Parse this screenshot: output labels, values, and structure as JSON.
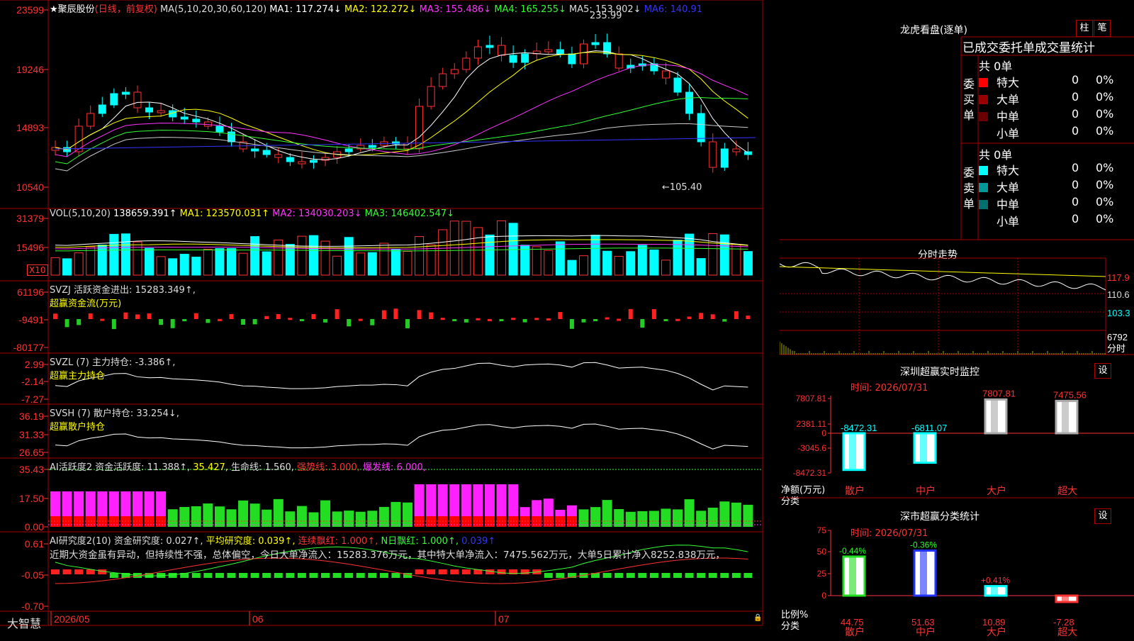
{
  "stock": {
    "star": "★",
    "name": "聚辰股份",
    "mode": "(日线，前复权)"
  },
  "ma_header": [
    {
      "label": "MA(5,10,20,30,60,120)",
      "color": "#dddddd"
    },
    {
      "label": "MA1: 117.274↓",
      "color": "#ffffff"
    },
    {
      "label": "MA2: 122.272↓",
      "color": "#ffff00"
    },
    {
      "label": "MA3: 155.486↓",
      "color": "#ff33ff"
    },
    {
      "label": "MA4: 165.255↓",
      "color": "#33ff33"
    },
    {
      "label": "MA5: 153.902↓",
      "color": "#dddddd"
    },
    {
      "label": "MA6: 140.91",
      "color": "#3333ff"
    }
  ],
  "price_axis": [
    "23599",
    "19246",
    "14893",
    "10540"
  ],
  "price_marks": {
    "high": "235.99",
    "low": "←105.40"
  },
  "vol_header": [
    {
      "label": "VOL(5,10,20)",
      "color": "#dddddd"
    },
    {
      "label": "138659.391↑",
      "color": "#ffffff"
    },
    {
      "label": "MA1: 123570.031↑",
      "color": "#ffff00"
    },
    {
      "label": "MA2: 134030.203↓",
      "color": "#ff33ff"
    },
    {
      "label": "MA3: 146402.547↓",
      "color": "#33ff33"
    }
  ],
  "vol_axis": [
    "31379",
    "15496"
  ],
  "vol_unit": "X10",
  "svzj": {
    "line1": "SVZJ  活跃资金进出: 15283.349↑,",
    "line2": "超赢资金流(万元)",
    "axis": [
      "61196",
      "-9491",
      "-80177"
    ]
  },
  "svzl": {
    "line1": "SVZL (7) 主力持仓: -3.386↑,",
    "line2": "超赢主力持仓",
    "axis": [
      "2.99",
      "-2.14",
      "-7.27"
    ]
  },
  "svsh": {
    "line1": "SVSH (7) 散户持仓: 33.254↓,",
    "line2": "超赢散户持仓",
    "axis": [
      "36.19",
      "31.33",
      "26.65"
    ]
  },
  "ai_active": {
    "header": [
      {
        "label": "AI活跃度2 资金活跃度: 11.388↑,",
        "color": "#dddddd"
      },
      {
        "label": "35.427,",
        "color": "#ffff00"
      },
      {
        "label": "生命线: 1.560,",
        "color": "#dddddd"
      },
      {
        "label": "强势线: 3.000,",
        "color": "#ff3232"
      },
      {
        "label": "爆发线: 6.000,",
        "color": "#ff33ff"
      }
    ],
    "axis": [
      "35.43",
      "17.50",
      "0.00"
    ]
  },
  "ai_research": {
    "header": [
      {
        "label": "AI研究度2(10) 资金研究度: 0.027↑,",
        "color": "#dddddd"
      },
      {
        "label": "平均研究度: 0.039↑,",
        "color": "#ffff00"
      },
      {
        "label": "连续飘红: 1.000↑,",
        "color": "#ff3232"
      },
      {
        "label": "N日飘红: 1.000↑,",
        "color": "#33ff33"
      },
      {
        "label": "0.039↑",
        "color": "#3333ff"
      }
    ],
    "comment": "近期大资金虽有异动，但持续性不强，总体偏空，今日大单净流入：15283.376万元，其中特大单净流入：7475.562万元，大单5日累计净入8252.838万元，",
    "axis": [
      "0.61",
      "-0.05",
      "-0.70"
    ]
  },
  "date_axis": [
    "2026/05",
    "06",
    "07"
  ],
  "brand": "大智慧",
  "dragon": {
    "title": "龙虎看盘(逐单)",
    "btn1": "柱",
    "btn2": "笔",
    "tabs": "已成交委托单成交量统计",
    "buy_label": "委买单",
    "sell_label": "委卖单",
    "buy_total": "共 0单",
    "sell_total": "共 0单",
    "buy_rows": [
      {
        "name": "特大",
        "count": "0",
        "pct": "0%",
        "color": "#ff0000"
      },
      {
        "name": "大单",
        "count": "0",
        "pct": "0%",
        "color": "#990000"
      },
      {
        "name": "中单",
        "count": "0",
        "pct": "0%",
        "color": "#6a0000"
      },
      {
        "name": "小单",
        "count": "0",
        "pct": "0%",
        "color": ""
      }
    ],
    "sell_rows": [
      {
        "name": "特大",
        "count": "0",
        "pct": "0%",
        "color": "#00ffff"
      },
      {
        "name": "大单",
        "count": "0",
        "pct": "0%",
        "color": "#009999"
      },
      {
        "name": "中单",
        "count": "0",
        "pct": "0%",
        "color": "#006f6f"
      },
      {
        "name": "小单",
        "count": "0",
        "pct": "0%",
        "color": ""
      }
    ]
  },
  "intraday": {
    "title": "分时走势",
    "axis": [
      "117.9",
      "110.6",
      "103.3"
    ],
    "vol_value": "6792",
    "vol_label": "分时"
  },
  "sz_monitor": {
    "title": "深圳超赢实时监控",
    "btn": "设",
    "time": "时间: 2026/07/31",
    "axis": [
      "7807.81",
      "2381.11",
      "0",
      "-3045.6",
      "-8472.31"
    ],
    "ylabel1": "净额(万元)",
    "ylabel2": "分类",
    "chart_data": {
      "type": "bar",
      "categories": [
        "散户",
        "中户",
        "大户",
        "超大"
      ],
      "values": [
        -8472.31,
        -6811.07,
        7807.81,
        7475.56
      ],
      "value_labels": [
        "-8472.31",
        "-6811.07",
        "7807.81",
        "7475.56"
      ],
      "ylabel": "净额(万元)",
      "ylim": [
        -8472.31,
        7807.81
      ]
    }
  },
  "sz_class": {
    "title": "深市超赢分类统计",
    "btn": "设",
    "time": "时间: 2026/07/31",
    "axis": [
      "75",
      "50",
      "25",
      "0"
    ],
    "ylabel1": "比例%",
    "ylabel2": "分类",
    "chart_data": {
      "type": "bar",
      "categories": [
        "散户",
        "中户",
        "大户",
        "超大"
      ],
      "values": [
        44.75,
        51.63,
        10.89,
        -7.28
      ],
      "changes": [
        "-0.44%",
        "-0.36%",
        "+0.41%",
        ""
      ],
      "value_labels": [
        "44.75",
        "51.63",
        "10.89",
        "-7.28"
      ],
      "ylabel": "比例%",
      "ylim": [
        0,
        75
      ]
    }
  }
}
